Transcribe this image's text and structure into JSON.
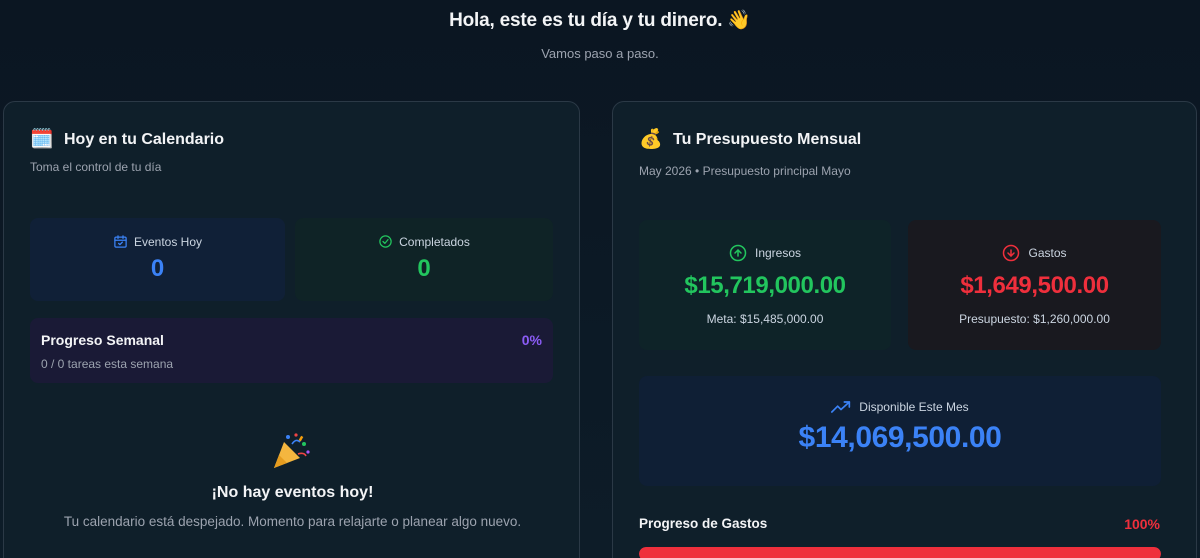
{
  "hero": {
    "title": "Hola, este es tu día y tu dinero. 👋",
    "subtitle": "Vamos paso a paso."
  },
  "calendar": {
    "emoji": "🗓️",
    "title": "Hoy en tu Calendario",
    "subtitle": "Toma el control de tu día",
    "events_today": {
      "label": "Eventos Hoy",
      "value": "0",
      "icon": "calendar-check-icon"
    },
    "completed": {
      "label": "Completados",
      "value": "0",
      "icon": "check-circle-icon"
    },
    "weekly": {
      "title": "Progreso Semanal",
      "percent": "0%",
      "detail": "0 / 0 tareas esta semana"
    },
    "empty": {
      "icon": "party-popper-icon",
      "title": "¡No hay eventos hoy!",
      "message": "Tu calendario está despejado. Momento para relajarte o planear algo nuevo."
    }
  },
  "budget": {
    "emoji": "💰",
    "title": "Tu Presupuesto Mensual",
    "subtitle": "May 2026 • Presupuesto principal Mayo",
    "income": {
      "label": "Ingresos",
      "amount": "$15,719,000.00",
      "meta": "Meta: $15,485,000.00",
      "icon": "arrow-up-circle-icon"
    },
    "expenses": {
      "label": "Gastos",
      "amount": "$1,649,500.00",
      "meta": "Presupuesto: $1,260,000.00",
      "icon": "arrow-down-circle-icon"
    },
    "available": {
      "label": "Disponible Este Mes",
      "amount": "$14,069,500.00",
      "icon": "trending-up-icon"
    },
    "progress": {
      "label": "Progreso de Gastos",
      "percent": "100%",
      "fraction": 1.0
    }
  },
  "colors": {
    "background": "#0c1a26",
    "income": "#22c55e",
    "expense": "#ef2f3c",
    "available": "#3b82f6",
    "weekly_accent": "#8b5cf6"
  }
}
